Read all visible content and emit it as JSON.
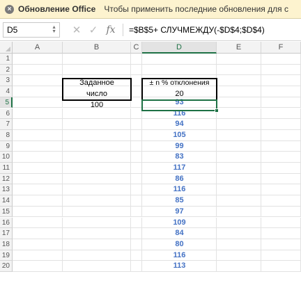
{
  "notification": {
    "title": "Обновление Office",
    "message": "Чтобы применить последние обновления для с"
  },
  "formula_bar": {
    "name_box": "D5",
    "cancel_icon": "close-icon",
    "enter_icon": "check-icon",
    "fx_label": "fx",
    "formula": "=$B$5+ СЛУЧМЕЖДУ(-$D$4;$D$4)"
  },
  "columns": [
    "A",
    "B",
    "C",
    "D",
    "E",
    "F"
  ],
  "rows": [
    "1",
    "2",
    "3",
    "4",
    "5",
    "6",
    "7",
    "8",
    "9",
    "10",
    "11",
    "12",
    "13",
    "14",
    "15",
    "16",
    "17",
    "18",
    "19",
    "20"
  ],
  "cells": {
    "b3": "Заданное",
    "b4": "число",
    "b5": "100",
    "d3": "±  n % отклонения",
    "d4": "20"
  },
  "results": [
    "93",
    "116",
    "94",
    "105",
    "99",
    "83",
    "117",
    "86",
    "116",
    "85",
    "97",
    "109",
    "84",
    "80",
    "116",
    "113"
  ],
  "colors": {
    "accent": "#1e7145",
    "value_text": "#4472c4",
    "notification_bg": "#fdf3cf"
  }
}
